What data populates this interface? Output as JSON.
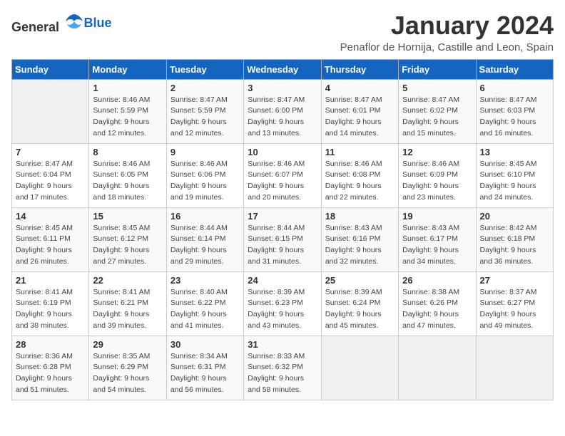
{
  "header": {
    "logo_general": "General",
    "logo_blue": "Blue",
    "title": "January 2024",
    "subtitle": "Penaflor de Hornija, Castille and Leon, Spain"
  },
  "columns": [
    "Sunday",
    "Monday",
    "Tuesday",
    "Wednesday",
    "Thursday",
    "Friday",
    "Saturday"
  ],
  "weeks": [
    [
      {
        "day": "",
        "sunrise": "",
        "sunset": "",
        "daylight": ""
      },
      {
        "day": "1",
        "sunrise": "Sunrise: 8:46 AM",
        "sunset": "Sunset: 5:59 PM",
        "daylight": "Daylight: 9 hours and 12 minutes."
      },
      {
        "day": "2",
        "sunrise": "Sunrise: 8:47 AM",
        "sunset": "Sunset: 5:59 PM",
        "daylight": "Daylight: 9 hours and 12 minutes."
      },
      {
        "day": "3",
        "sunrise": "Sunrise: 8:47 AM",
        "sunset": "Sunset: 6:00 PM",
        "daylight": "Daylight: 9 hours and 13 minutes."
      },
      {
        "day": "4",
        "sunrise": "Sunrise: 8:47 AM",
        "sunset": "Sunset: 6:01 PM",
        "daylight": "Daylight: 9 hours and 14 minutes."
      },
      {
        "day": "5",
        "sunrise": "Sunrise: 8:47 AM",
        "sunset": "Sunset: 6:02 PM",
        "daylight": "Daylight: 9 hours and 15 minutes."
      },
      {
        "day": "6",
        "sunrise": "Sunrise: 8:47 AM",
        "sunset": "Sunset: 6:03 PM",
        "daylight": "Daylight: 9 hours and 16 minutes."
      }
    ],
    [
      {
        "day": "7",
        "sunrise": "Sunrise: 8:47 AM",
        "sunset": "Sunset: 6:04 PM",
        "daylight": "Daylight: 9 hours and 17 minutes."
      },
      {
        "day": "8",
        "sunrise": "Sunrise: 8:46 AM",
        "sunset": "Sunset: 6:05 PM",
        "daylight": "Daylight: 9 hours and 18 minutes."
      },
      {
        "day": "9",
        "sunrise": "Sunrise: 8:46 AM",
        "sunset": "Sunset: 6:06 PM",
        "daylight": "Daylight: 9 hours and 19 minutes."
      },
      {
        "day": "10",
        "sunrise": "Sunrise: 8:46 AM",
        "sunset": "Sunset: 6:07 PM",
        "daylight": "Daylight: 9 hours and 20 minutes."
      },
      {
        "day": "11",
        "sunrise": "Sunrise: 8:46 AM",
        "sunset": "Sunset: 6:08 PM",
        "daylight": "Daylight: 9 hours and 22 minutes."
      },
      {
        "day": "12",
        "sunrise": "Sunrise: 8:46 AM",
        "sunset": "Sunset: 6:09 PM",
        "daylight": "Daylight: 9 hours and 23 minutes."
      },
      {
        "day": "13",
        "sunrise": "Sunrise: 8:45 AM",
        "sunset": "Sunset: 6:10 PM",
        "daylight": "Daylight: 9 hours and 24 minutes."
      }
    ],
    [
      {
        "day": "14",
        "sunrise": "Sunrise: 8:45 AM",
        "sunset": "Sunset: 6:11 PM",
        "daylight": "Daylight: 9 hours and 26 minutes."
      },
      {
        "day": "15",
        "sunrise": "Sunrise: 8:45 AM",
        "sunset": "Sunset: 6:12 PM",
        "daylight": "Daylight: 9 hours and 27 minutes."
      },
      {
        "day": "16",
        "sunrise": "Sunrise: 8:44 AM",
        "sunset": "Sunset: 6:14 PM",
        "daylight": "Daylight: 9 hours and 29 minutes."
      },
      {
        "day": "17",
        "sunrise": "Sunrise: 8:44 AM",
        "sunset": "Sunset: 6:15 PM",
        "daylight": "Daylight: 9 hours and 31 minutes."
      },
      {
        "day": "18",
        "sunrise": "Sunrise: 8:43 AM",
        "sunset": "Sunset: 6:16 PM",
        "daylight": "Daylight: 9 hours and 32 minutes."
      },
      {
        "day": "19",
        "sunrise": "Sunrise: 8:43 AM",
        "sunset": "Sunset: 6:17 PM",
        "daylight": "Daylight: 9 hours and 34 minutes."
      },
      {
        "day": "20",
        "sunrise": "Sunrise: 8:42 AM",
        "sunset": "Sunset: 6:18 PM",
        "daylight": "Daylight: 9 hours and 36 minutes."
      }
    ],
    [
      {
        "day": "21",
        "sunrise": "Sunrise: 8:41 AM",
        "sunset": "Sunset: 6:19 PM",
        "daylight": "Daylight: 9 hours and 38 minutes."
      },
      {
        "day": "22",
        "sunrise": "Sunrise: 8:41 AM",
        "sunset": "Sunset: 6:21 PM",
        "daylight": "Daylight: 9 hours and 39 minutes."
      },
      {
        "day": "23",
        "sunrise": "Sunrise: 8:40 AM",
        "sunset": "Sunset: 6:22 PM",
        "daylight": "Daylight: 9 hours and 41 minutes."
      },
      {
        "day": "24",
        "sunrise": "Sunrise: 8:39 AM",
        "sunset": "Sunset: 6:23 PM",
        "daylight": "Daylight: 9 hours and 43 minutes."
      },
      {
        "day": "25",
        "sunrise": "Sunrise: 8:39 AM",
        "sunset": "Sunset: 6:24 PM",
        "daylight": "Daylight: 9 hours and 45 minutes."
      },
      {
        "day": "26",
        "sunrise": "Sunrise: 8:38 AM",
        "sunset": "Sunset: 6:26 PM",
        "daylight": "Daylight: 9 hours and 47 minutes."
      },
      {
        "day": "27",
        "sunrise": "Sunrise: 8:37 AM",
        "sunset": "Sunset: 6:27 PM",
        "daylight": "Daylight: 9 hours and 49 minutes."
      }
    ],
    [
      {
        "day": "28",
        "sunrise": "Sunrise: 8:36 AM",
        "sunset": "Sunset: 6:28 PM",
        "daylight": "Daylight: 9 hours and 51 minutes."
      },
      {
        "day": "29",
        "sunrise": "Sunrise: 8:35 AM",
        "sunset": "Sunset: 6:29 PM",
        "daylight": "Daylight: 9 hours and 54 minutes."
      },
      {
        "day": "30",
        "sunrise": "Sunrise: 8:34 AM",
        "sunset": "Sunset: 6:31 PM",
        "daylight": "Daylight: 9 hours and 56 minutes."
      },
      {
        "day": "31",
        "sunrise": "Sunrise: 8:33 AM",
        "sunset": "Sunset: 6:32 PM",
        "daylight": "Daylight: 9 hours and 58 minutes."
      },
      {
        "day": "",
        "sunrise": "",
        "sunset": "",
        "daylight": ""
      },
      {
        "day": "",
        "sunrise": "",
        "sunset": "",
        "daylight": ""
      },
      {
        "day": "",
        "sunrise": "",
        "sunset": "",
        "daylight": ""
      }
    ]
  ]
}
